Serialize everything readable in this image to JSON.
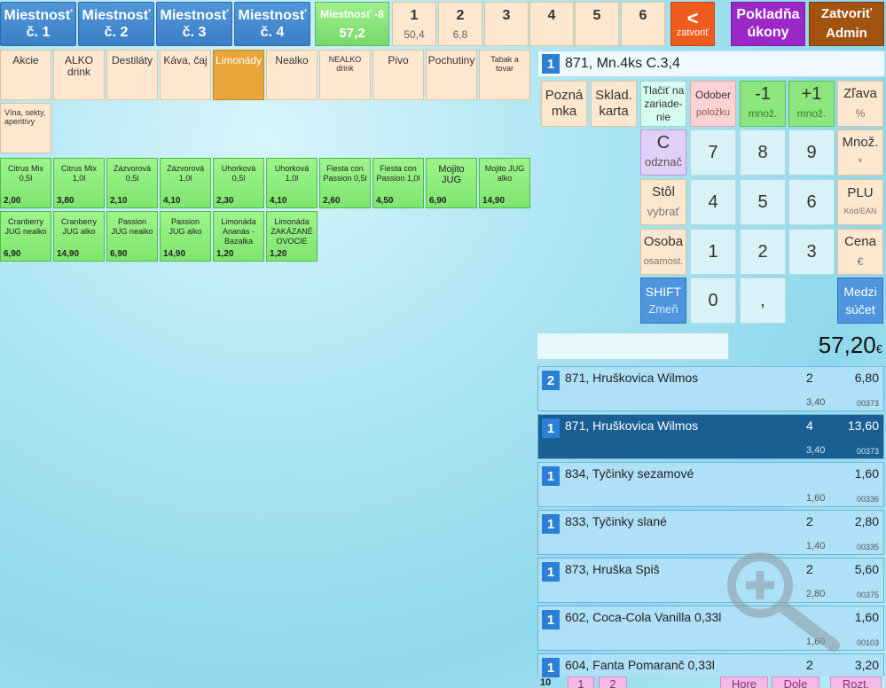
{
  "top": {
    "rooms": [
      {
        "line1": "Miestnosť",
        "line2": "č. 1"
      },
      {
        "line1": "Miestnosť",
        "line2": "č. 2"
      },
      {
        "line1": "Miestnosť",
        "line2": "č. 3"
      },
      {
        "line1": "Miestnosť",
        "line2": "č. 4"
      }
    ],
    "active_room": {
      "label": "Miestnosť -8",
      "value": "57,2"
    },
    "pages": [
      {
        "n": "1",
        "sub": "50,4"
      },
      {
        "n": "2",
        "sub": "6,8"
      },
      {
        "n": "3",
        "sub": ""
      },
      {
        "n": "4",
        "sub": ""
      },
      {
        "n": "5",
        "sub": ""
      },
      {
        "n": "6",
        "sub": ""
      }
    ],
    "close": {
      "arrow": "<",
      "label": "zatvoriť"
    },
    "cash": {
      "line1": "Pokladňa",
      "line2": "úkony"
    },
    "admin": {
      "line1": "Zatvoriť",
      "line2": "Admin"
    }
  },
  "categories": [
    "Akcie",
    "ALKO drink",
    "Destiláty",
    "Káva, čaj",
    "Limonády",
    "Nealko",
    "NEALKO drink",
    "Pivo",
    "Pochutiny",
    "Tabak a tovar",
    "Vína, sekty, aperitívy"
  ],
  "products": [
    {
      "name": "Citrus Mix 0,5l",
      "price": "2,00"
    },
    {
      "name": "Citrus Mix 1,0l",
      "price": "3,80"
    },
    {
      "name": "Zázvorová 0,5l",
      "price": "2,10"
    },
    {
      "name": "Zázvorová 1,0l",
      "price": "4,10"
    },
    {
      "name": "Uhorková 0,5l",
      "price": "2,30"
    },
    {
      "name": "Uhorková 1,0l",
      "price": "4,10"
    },
    {
      "name": "Fiesta con Passion 0,5l",
      "price": "2,60"
    },
    {
      "name": "Fiesta con Passion 1,0l",
      "price": "4,50"
    },
    {
      "name": "Mojito JUG",
      "price": "6,90"
    },
    {
      "name": "Mojito JUG alko",
      "price": "14,90"
    },
    {
      "name": "Cranberry JUG nealko",
      "price": "6,90"
    },
    {
      "name": "Cranberry JUG alko",
      "price": "14,90"
    },
    {
      "name": "Passion JUG nealko",
      "price": "6,90"
    },
    {
      "name": "Passion JUG alko",
      "price": "14,90"
    },
    {
      "name": "Limonáda Ananás - Bazalka",
      "price": "1,20"
    },
    {
      "name": "Limonáda ZAKÁZANÉ OVOCIE",
      "price": "1,20"
    }
  ],
  "order_header": {
    "qty": "1",
    "text": "871,  Mn.4ks C.3,4"
  },
  "functions": {
    "note": {
      "l1": "Pozná",
      "l2": "mka"
    },
    "stock": {
      "l1": "Sklad.",
      "l2": "karta"
    },
    "print": {
      "l1": "Tlačiť na",
      "l2": "zariade-",
      "l3": "nie"
    },
    "remove": {
      "l1": "Odober",
      "l2": "položku"
    },
    "minus": {
      "l1": "-1",
      "l2": "množ."
    },
    "plus": {
      "l1": "+1",
      "l2": "množ."
    },
    "discount": {
      "l1": "Zľava",
      "l2": "%"
    },
    "clear": {
      "l1": "C",
      "l2": "odznač"
    },
    "qty": {
      "l1": "Množ.",
      "l2": "*"
    },
    "table": {
      "l1": "Stôl",
      "l2": "vybrať"
    },
    "plu": {
      "l1": "PLU",
      "l2": "Kód/EAN"
    },
    "person": {
      "l1": "Osoba",
      "l2": "osamost."
    },
    "price": {
      "l1": "Cena",
      "l2": "€"
    },
    "shift": {
      "l1": "SHIFT",
      "l2": "Zmeň"
    },
    "subtotal": {
      "l1": "Medzi",
      "l2": "súčet"
    }
  },
  "keypad": {
    "k7": "7",
    "k8": "8",
    "k9": "9",
    "k4": "4",
    "k5": "5",
    "k6": "6",
    "k1": "1",
    "k2": "2",
    "k3": "3",
    "k0": "0",
    "comma": ","
  },
  "total": {
    "value": "57,20",
    "currency": "€"
  },
  "items": [
    {
      "badge": "2",
      "name": "871, Hruškovica Wilmos",
      "qty": "2",
      "sum": "6,80",
      "unit": "3,40",
      "code": "00373"
    },
    {
      "badge": "1",
      "name": "871, Hruškovica Wilmos",
      "qty": "4",
      "sum": "13,60",
      "unit": "3,40",
      "code": "00373"
    },
    {
      "badge": "1",
      "name": "834, Tyčinky sezamové",
      "qty": "",
      "sum": "1,60",
      "unit": "1,60",
      "code": "00336"
    },
    {
      "badge": "1",
      "name": "833, Tyčinky slané",
      "qty": "2",
      "sum": "2,80",
      "unit": "1,40",
      "code": "00335"
    },
    {
      "badge": "1",
      "name": "873, Hruška Spiš",
      "qty": "2",
      "sum": "5,60",
      "unit": "2,80",
      "code": "00375"
    },
    {
      "badge": "1",
      "name": "602, Coca-Cola Vanilla 0,33l",
      "qty": "",
      "sum": "1,60",
      "unit": "1,60",
      "code": "00103"
    },
    {
      "badge": "1",
      "name": "604, Fanta Pomaranč 0,33l",
      "qty": "2",
      "sum": "3,20",
      "unit": "",
      "code": ""
    }
  ],
  "bottom": {
    "count": "10",
    "p1": "1",
    "p2": "2",
    "up": "Hore",
    "down": "Dole",
    "split": "Rozt."
  }
}
